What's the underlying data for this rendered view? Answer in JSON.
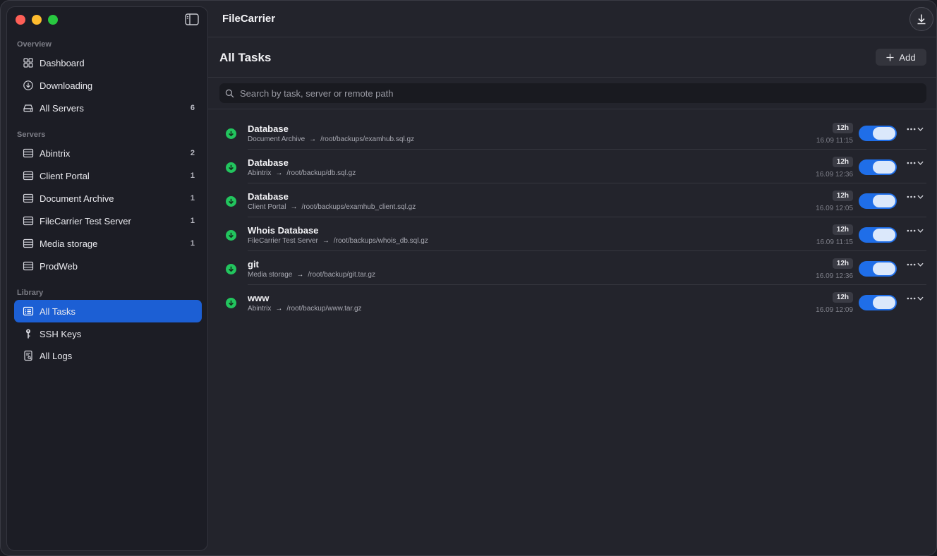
{
  "app": {
    "title": "FileCarrier"
  },
  "sidebar": {
    "sections": {
      "overview": "Overview",
      "servers": "Servers",
      "library": "Library"
    },
    "overview_items": [
      {
        "label": "Dashboard",
        "icon": "grid-icon"
      },
      {
        "label": "Downloading",
        "icon": "download-circle-icon"
      },
      {
        "label": "All Servers",
        "icon": "server-stack-icon",
        "count": "6"
      }
    ],
    "server_items": [
      {
        "label": "Abintrix",
        "count": "2"
      },
      {
        "label": "Client Portal",
        "count": "1"
      },
      {
        "label": "Document Archive",
        "count": "1"
      },
      {
        "label": "FileCarrier Test Server",
        "count": "1"
      },
      {
        "label": "Media storage",
        "count": "1"
      },
      {
        "label": "ProdWeb",
        "count": ""
      }
    ],
    "library_items": [
      {
        "label": "All Tasks",
        "icon": "tasks-icon",
        "active": true
      },
      {
        "label": "SSH Keys",
        "icon": "key-icon"
      },
      {
        "label": "All Logs",
        "icon": "logs-icon"
      }
    ]
  },
  "header": {
    "title": "All Tasks",
    "add_label": "Add"
  },
  "search": {
    "placeholder": "Search by task, server or remote path"
  },
  "tasks": [
    {
      "name": "Database",
      "server": "Document Archive",
      "path": "/root/backups/examhub.sql.gz",
      "interval": "12h",
      "last_run": "16.09 11:15",
      "enabled": true
    },
    {
      "name": "Database",
      "server": "Abintrix",
      "path": "/root/backup/db.sql.gz",
      "interval": "12h",
      "last_run": "16.09 12:36",
      "enabled": true
    },
    {
      "name": "Database",
      "server": "Client Portal",
      "path": "/root/backups/examhub_client.sql.gz",
      "interval": "12h",
      "last_run": "16.09 12:05",
      "enabled": true
    },
    {
      "name": "Whois Database",
      "server": "FileCarrier Test Server",
      "path": "/root/backups/whois_db.sql.gz",
      "interval": "12h",
      "last_run": "16.09 11:15",
      "enabled": true
    },
    {
      "name": "git",
      "server": "Media storage",
      "path": "/root/backup/git.tar.gz",
      "interval": "12h",
      "last_run": "16.09 12:36",
      "enabled": true
    },
    {
      "name": "www",
      "server": "Abintrix",
      "path": "/root/backup/www.tar.gz",
      "interval": "12h",
      "last_run": "16.09 12:09",
      "enabled": true
    }
  ],
  "colors": {
    "accent": "#1c5fd4",
    "toggle_on": "#1f6ee8",
    "status_ok": "#22c55e"
  }
}
